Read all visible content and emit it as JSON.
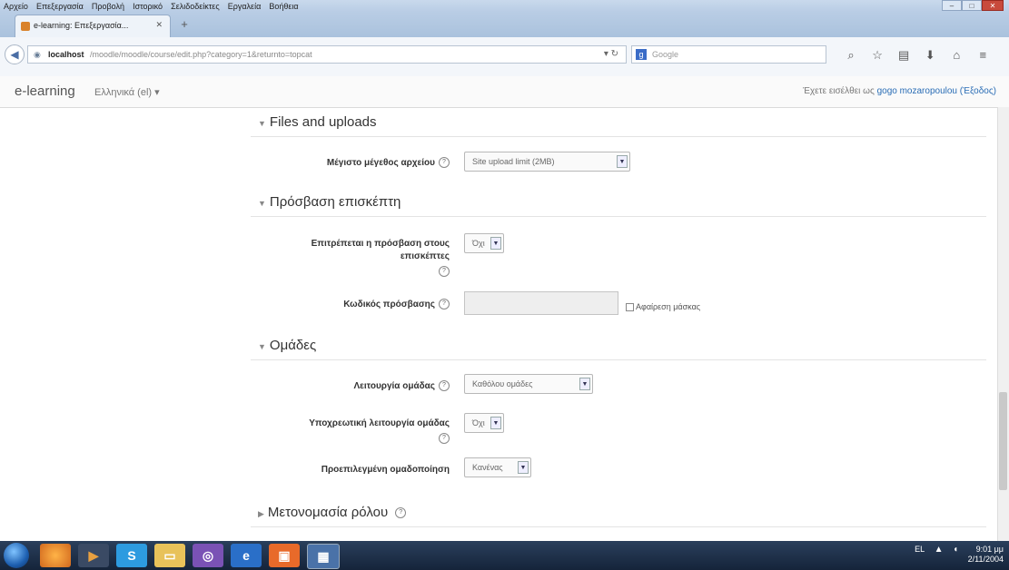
{
  "window": {
    "menu": [
      "Αρχείο",
      "Επεξεργασία",
      "Προβολή",
      "Ιστορικό",
      "Σελιδοδείκτες",
      "Εργαλεία",
      "Βοήθεια"
    ],
    "tab_title": "e-learning: Επεξεργασία...",
    "url_host": "localhost",
    "url_path": "/moodle/moodle/course/edit.php?category=1&returnto=topcat",
    "search_engine": "Google"
  },
  "header": {
    "brand": "e-learning",
    "language": "Ελληνικά (el) ▾",
    "login_prefix": "Έχετε εισέλθει ως ",
    "login_user": "gogo mozaropoulou",
    "logout": "(Έξοδος)"
  },
  "form": {
    "files": {
      "title": "Files and uploads",
      "max_size_label": "Μέγιστο μέγεθος αρχείου",
      "max_size_value": "Site upload limit (2MB)"
    },
    "guest": {
      "title": "Πρόσβαση επισκέπτη",
      "allow_label": "Επιτρέπεται η πρόσβαση στους επισκέπτες",
      "allow_value": "Όχι",
      "password_label": "Κωδικός πρόσβασης",
      "unmask_label": "Αφαίρεση μάσκας"
    },
    "groups": {
      "title": "Ομάδες",
      "mode_label": "Λειτουργία ομάδας",
      "mode_value": "Καθόλου ομάδες",
      "force_label": "Υποχρεωτική λειτουργία ομάδας",
      "force_value": "Όχι",
      "default_label": "Προεπιλεγμένη ομαδοποίηση",
      "default_value": "Κανένας"
    },
    "roles": {
      "title": "Μετονομασία ρόλου"
    }
  },
  "taskbar": {
    "lang": "EL",
    "time": "9:01 μμ",
    "date": "2/11/2004"
  }
}
